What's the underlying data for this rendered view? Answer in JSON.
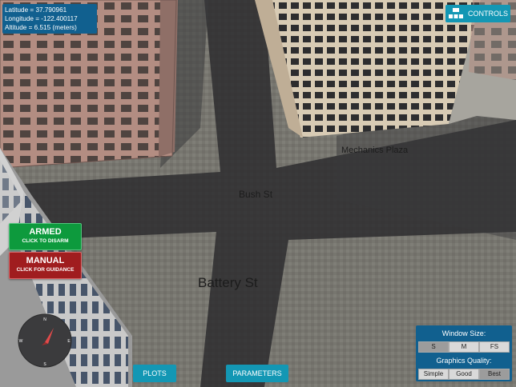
{
  "coordinates": {
    "latitude": "Latitude = 37.790961",
    "longitude": "Longitude = -122.400117",
    "altitude": "Altitude = 6.515 (meters)"
  },
  "controls_button": {
    "label": "CONTROLS",
    "icon": "controls-grid-icon"
  },
  "map_labels": {
    "street_1": "Mechanics Plaza",
    "street_2": "Bush St",
    "street_3": "Battery St"
  },
  "armed_button": {
    "title": "ARMED",
    "subtitle": "CLICK TO DISARM",
    "color": "#0d9a3d"
  },
  "manual_button": {
    "title": "MANUAL",
    "subtitle": "CLICK FOR GUIDANCE",
    "color": "#a01d1f"
  },
  "compass": {
    "north": "N",
    "south": "S",
    "east": "E",
    "west": "W",
    "icon": "compass-needle-icon"
  },
  "bottom_buttons": {
    "plots": "PLOTS",
    "parameters": "PARAMETERS"
  },
  "settings": {
    "window_size_title": "Window Size:",
    "window_size_options": [
      "S",
      "M",
      "FS"
    ],
    "window_size_selected": "S",
    "graphics_title": "Graphics Quality:",
    "graphics_options": [
      "Simple",
      "Good",
      "Best"
    ],
    "graphics_selected": "Best"
  },
  "colors": {
    "panel": "#11608f",
    "button": "#1397b4"
  }
}
